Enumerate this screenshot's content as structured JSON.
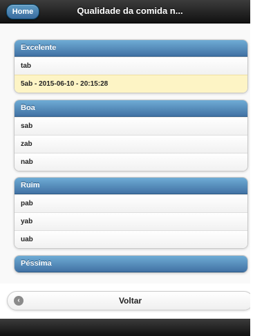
{
  "header": {
    "home_label": "Home",
    "title": "Qualidade da comida n..."
  },
  "groups": [
    {
      "label": "Excelente",
      "rows": [
        "tab",
        "5ab - 2015-06-10 - 20:15:28"
      ]
    },
    {
      "label": "Boa",
      "rows": [
        "sab",
        "zab",
        "nab"
      ]
    },
    {
      "label": "Ruim",
      "rows": [
        "pab",
        "yab",
        "uab"
      ]
    },
    {
      "label": "Péssima",
      "rows": []
    }
  ],
  "footer_button": {
    "label": "Voltar",
    "icon": "back-arrow-icon"
  },
  "colors": {
    "header_bg": "#1e1e1e",
    "divider_bg": "#4f86b8",
    "highlight_row": "#fdf4c5"
  }
}
